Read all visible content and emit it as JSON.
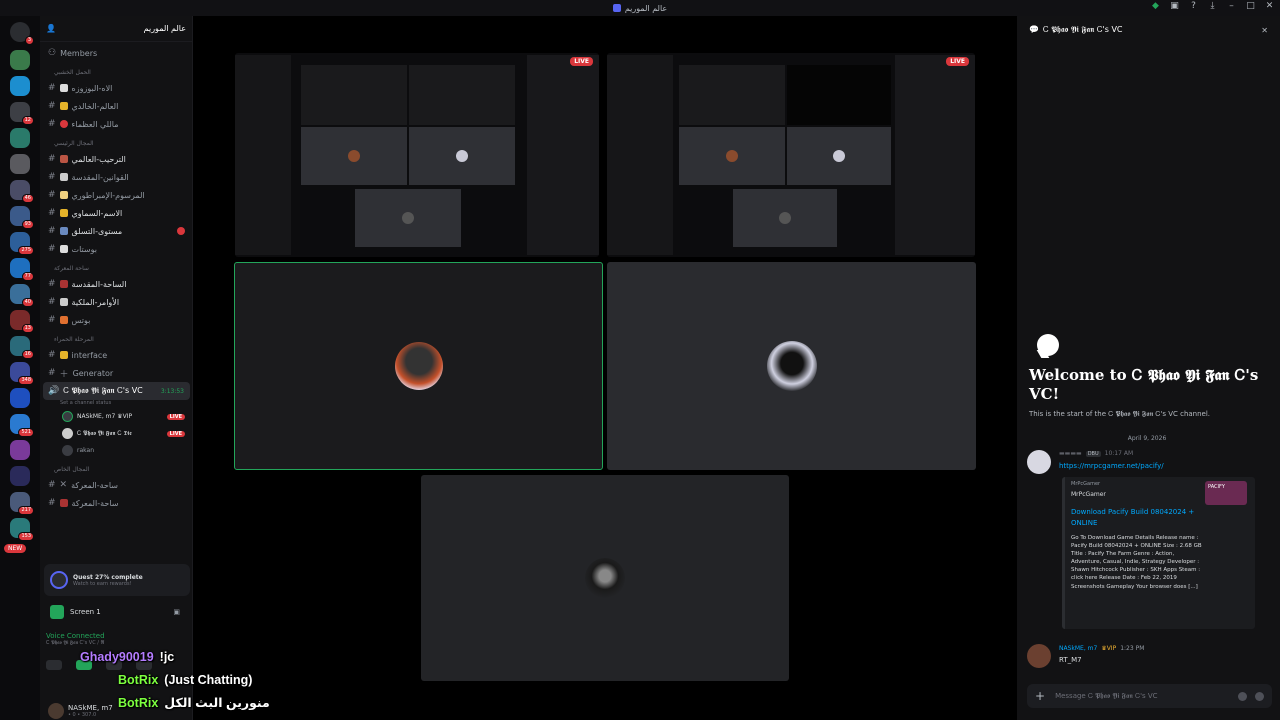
{
  "window": {
    "title": "عالم الموريم"
  },
  "rail": {
    "new_label": "NEW",
    "badges": [
      "3",
      "1",
      "12",
      "46",
      "93",
      "275",
      "77",
      "40",
      "13",
      "16",
      "348",
      "521",
      "217",
      "153"
    ]
  },
  "guild": {
    "name": "عالم الموريم"
  },
  "channels": {
    "members": "Members",
    "cat1": "الحمل الخشبي",
    "c1": "الاه-البوزوزه",
    "c2": "العالم-الخالدي",
    "c3": "ماللي العظماء",
    "cat2": "المجال الرئيسي",
    "c4": "الترحيب-العالمي",
    "c5": "القوانين-المقدسة",
    "c6": "المرسوم-الإمبراطوري",
    "c7": "الاسم-السماوي",
    "c8": "مستوى-التسلق",
    "c9": "بوستات",
    "cat3": "ساحة المعركة",
    "c10": "الساحة-المقدسة",
    "c11": "الأوامر-الملكية",
    "c12": "بوتس",
    "cat4": "المرحلة الحمراء",
    "c13": "interface",
    "c14": "Generator",
    "voice_channel": "Ꮯ 𝕻𝖍𝖆𝖔 𝖄𝖎 𝕱𝖆𝖓 Ꮯ's VC",
    "voice_timer": "3:13:53",
    "voice_status": "Set a channel status",
    "vu1": "NASkME, m7 ♛VIP",
    "vu2": "Ꮯ 𝕻𝖍𝖆𝖔 𝖄𝖎 𝕱𝖆𝖓 Ꮯ 𝕯𝖎𝖊",
    "vu3": "rakan",
    "live": "LIVE",
    "cat5": "المجال الخاص",
    "c15": "ساحة-المعركة",
    "c16": "ساحة-المعركة"
  },
  "quest": {
    "title": "Quest 27% complete",
    "sub": "Watch to earn rewards!"
  },
  "screen": {
    "label": "Screen 1"
  },
  "voice": {
    "status": "Voice Connected",
    "channel": "Ꮯ 𝕻𝖍𝖆𝖔 𝖄𝖎 𝕱𝖆𝖓 Ꮯ's VC / 𝕬"
  },
  "user": {
    "name": "NASkME, m7",
    "status": "• 0 • 307.0"
  },
  "stage": {
    "live": "LIVE"
  },
  "right": {
    "channel": "Ꮯ 𝕻𝖍𝖆𝖔 𝖄𝖎 𝕱𝖆𝖓 Ꮯ's VC",
    "welcome_title": "Welcome to Ꮯ 𝕻𝖍𝖆𝖔 𝖄𝖎 𝕱𝖆𝖓 Ꮯ's VC!",
    "welcome_sub": "This is the start of the Ꮯ 𝕻𝖍𝖆𝖔 𝖄𝖎 𝕱𝖆𝖓 Ꮯ's VC channel.",
    "date": "April 9, 2026",
    "msg1": {
      "tag": "DBU",
      "time": "10:17 AM",
      "link": "https://mrpcgamer.net/pacify/"
    },
    "embed": {
      "provider": "MrPcGamer",
      "author": "MrPcGamer",
      "title": "Download Pacify Build 08042024 + ONLINE",
      "desc": "Go To Download Game Details Release name : Pacify Build 08042024 + ONLINE Size : 2.68 GB Title : Pacify The Farm Genre : Action, Adventure, Casual, Indie, Strategy Developer : Shawn Hitchcock Publisher : SKH Apps Steam : click here Release Date : Feb 22, 2019 Screenshots Gameplay Your browser does [...]",
      "thumb": "PACIFY"
    },
    "msg2": {
      "name": "NASkME, m7",
      "vip": "♛VIP",
      "time": "1:23 PM",
      "text": "RT_M7"
    },
    "composer": "Message Ꮯ 𝕻𝖍𝖆𝖔 𝖄𝖎 𝕱𝖆𝖓 Ꮯ's VC"
  },
  "overlay": [
    {
      "user": "Ghady90019",
      "msg": "!jc"
    },
    {
      "user": "BotRix",
      "msg": "(Just Chatting)"
    },
    {
      "user": "BotRix",
      "msg": "منورين البث الكل"
    }
  ],
  "colors": {
    "accent": "#5865f2",
    "live": "#da373c",
    "online": "#23a55a",
    "link": "#00a8fc"
  }
}
